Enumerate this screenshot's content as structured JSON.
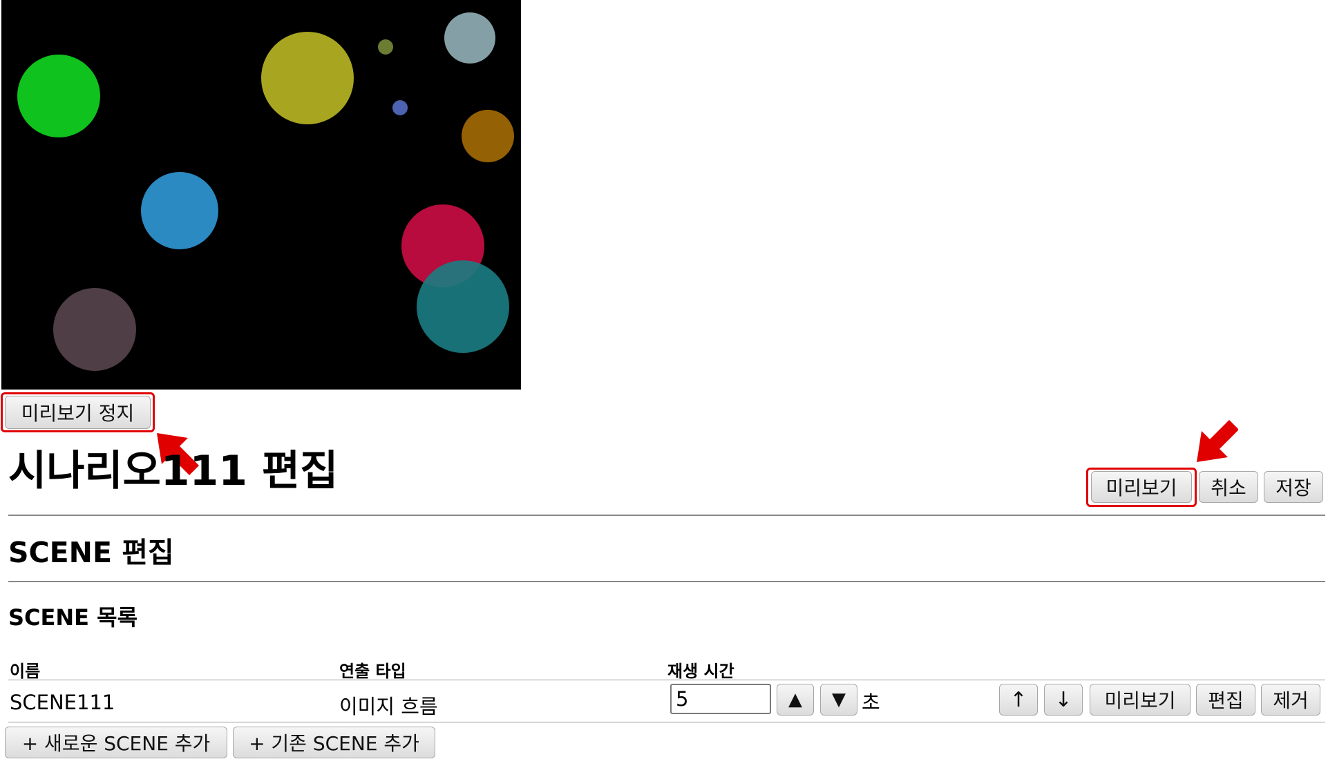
{
  "preview": {
    "circles": [
      {
        "color": "#0fc21d"
      },
      {
        "color": "#a8a621"
      },
      {
        "color": "#6b7d32"
      },
      {
        "color": "#84a0a6"
      },
      {
        "color": "#4d62b0"
      },
      {
        "color": "#946104"
      },
      {
        "color": "#2b8ac2"
      },
      {
        "color": "#b70c3d"
      },
      {
        "color": "#1a7d83"
      },
      {
        "color": "#4f3e45"
      }
    ],
    "stop_button_label": "미리보기 정지"
  },
  "header": {
    "title": "시나리오111 편집",
    "preview_label": "미리보기",
    "cancel_label": "취소",
    "save_label": "저장"
  },
  "scene_section": {
    "heading": "SCENE 편집",
    "list_heading": "SCENE 목록",
    "columns": [
      "이름",
      "연출 타입",
      "재생 시간"
    ],
    "rows": [
      {
        "name": "SCENE111",
        "effect_type": "이미지 흐름",
        "duration": "5",
        "duration_unit": "초",
        "up_icon": "↑",
        "down_icon": "↓",
        "increment_icon": "▲",
        "decrement_icon": "▼",
        "preview_label": "미리보기",
        "edit_label": "편집",
        "remove_label": "제거"
      }
    ],
    "add_new_label": "+ 새로운 SCENE 추가",
    "add_existing_label": "+ 기존 SCENE 추가"
  },
  "annotations": {
    "highlight_color": "#e00000",
    "arrow_color": "#e00000"
  }
}
